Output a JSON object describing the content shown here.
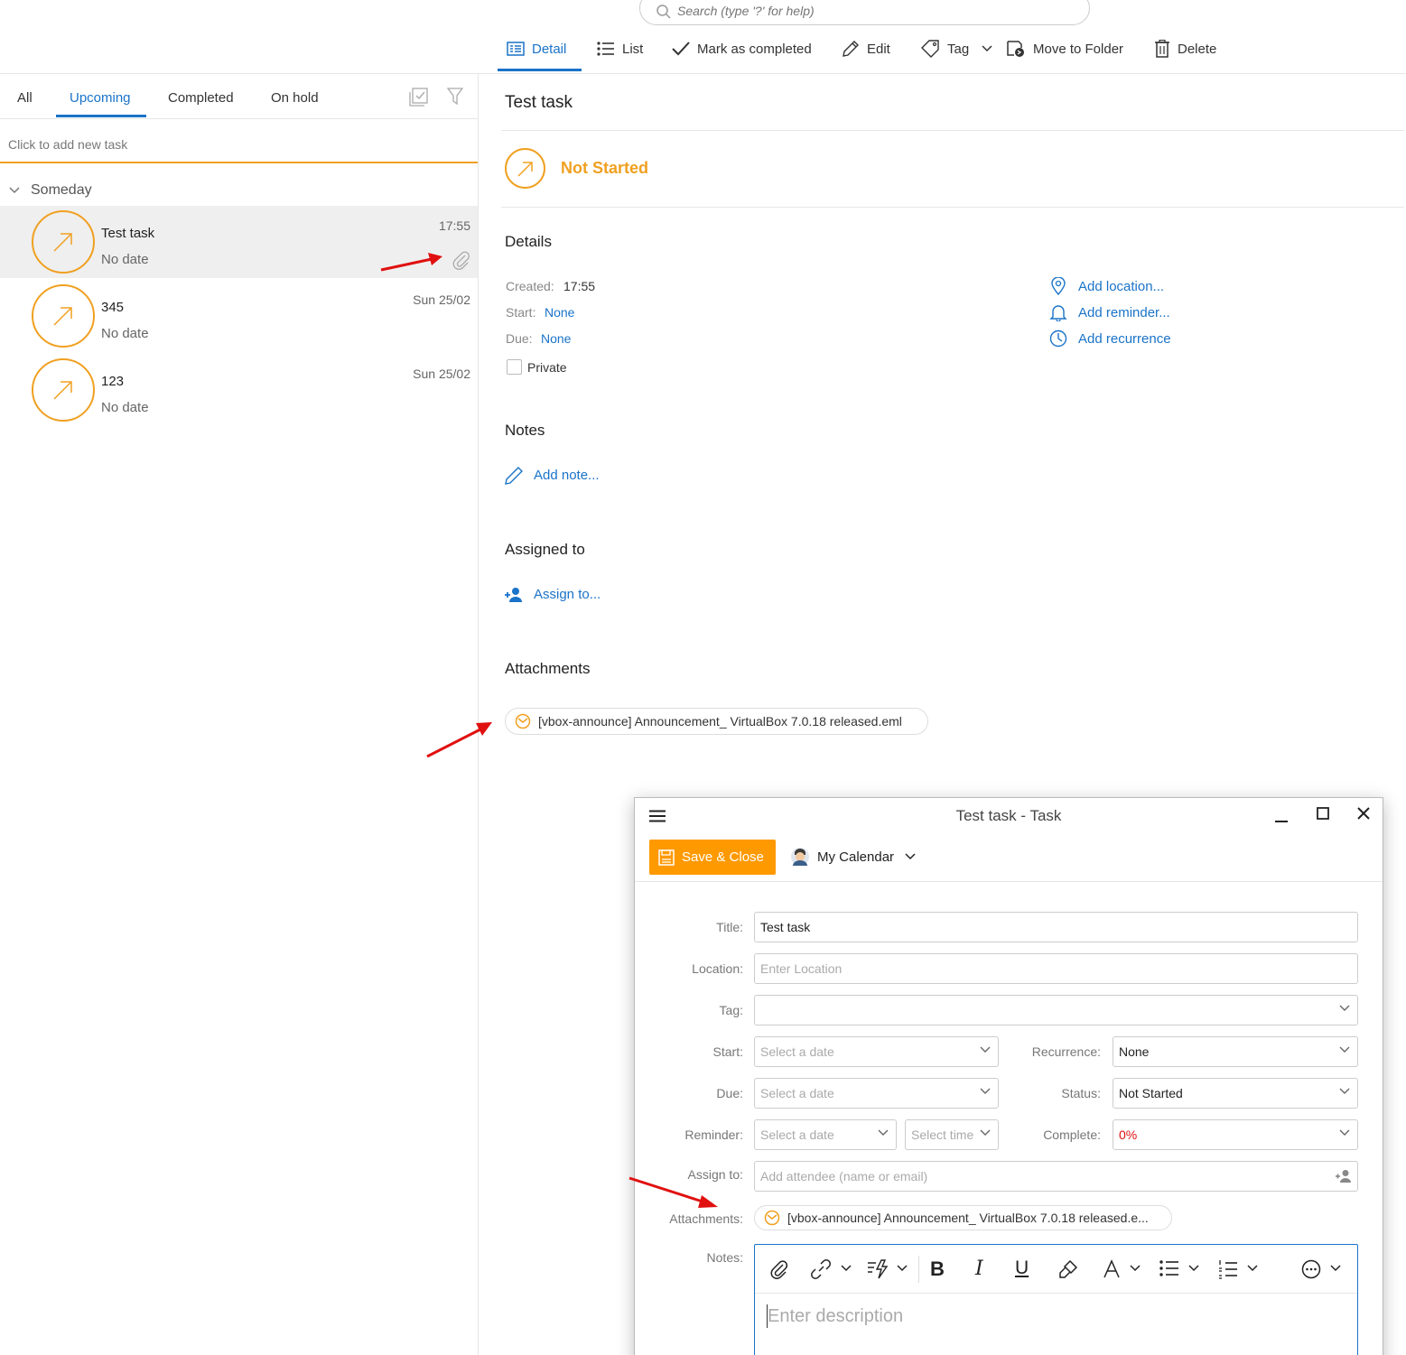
{
  "search": {
    "placeholder": "Search (type '?' for help)"
  },
  "toolbar": {
    "detail": "Detail",
    "list": "List",
    "mark_completed": "Mark as completed",
    "edit": "Edit",
    "tag": "Tag",
    "move_to_folder": "Move to Folder",
    "delete": "Delete"
  },
  "tabs": {
    "all": "All",
    "upcoming": "Upcoming",
    "completed": "Completed",
    "on_hold": "On hold"
  },
  "new_task": "Click to add new task",
  "group": "Someday",
  "tasks": [
    {
      "title": "Test task",
      "sub": "No date",
      "time": "17:55"
    },
    {
      "title": "345",
      "sub": "No date",
      "time": "Sun 25/02"
    },
    {
      "title": "123",
      "sub": "No date",
      "time": "Sun 25/02"
    }
  ],
  "detail": {
    "title": "Test task",
    "status": "Not Started",
    "details_heading": "Details",
    "created_label": "Created:",
    "created_value": "17:55",
    "start_label": "Start:",
    "start_value": "None",
    "due_label": "Due:",
    "due_value": "None",
    "private_label": "Private",
    "add_location": "Add location...",
    "add_reminder": "Add reminder...",
    "add_recurrence": "Add recurrence",
    "notes_heading": "Notes",
    "add_note": "Add note...",
    "assigned_heading": "Assigned to",
    "assign_to": "Assign to...",
    "attachments_heading": "Attachments",
    "attachment": "[vbox-announce] Announcement_ VirtualBox 7.0.18 released.eml"
  },
  "dialog": {
    "title": "Test task - Task",
    "save_close": "Save & Close",
    "calendar": "My Calendar",
    "labels": {
      "title": "Title:",
      "location": "Location:",
      "tag": "Tag:",
      "start": "Start:",
      "due": "Due:",
      "reminder": "Reminder:",
      "assign_to": "Assign to:",
      "attachments": "Attachments:",
      "notes": "Notes:",
      "recurrence": "Recurrence:",
      "status": "Status:",
      "complete": "Complete:"
    },
    "values": {
      "title": "Test task",
      "location_placeholder": "Enter Location",
      "start_placeholder": "Select a date",
      "due_placeholder": "Select a date",
      "reminder_date_placeholder": "Select a date",
      "reminder_time_placeholder": "Select time",
      "recurrence": "None",
      "status": "Not Started",
      "complete": "0%",
      "assign_placeholder": "Add attendee (name or email)",
      "attachment": "[vbox-announce] Announcement_ VirtualBox 7.0.18 released.e...",
      "notes_placeholder": "Enter description"
    }
  },
  "colors": {
    "accent": "#1a73c8",
    "orange": "#f0a020",
    "save_button": "#ff9900",
    "arrow": "#e01010"
  }
}
